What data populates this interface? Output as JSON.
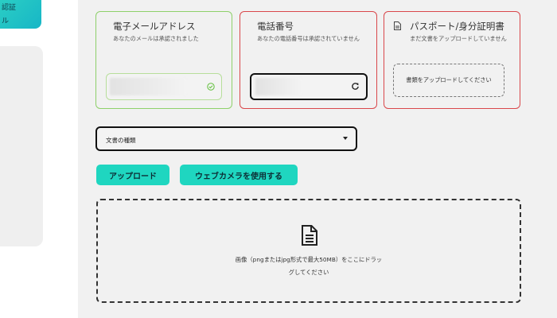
{
  "sidebar": {
    "active_item_lines": [
      "認証",
      "ル"
    ]
  },
  "verification": {
    "email": {
      "title": "電子メールアドレス",
      "description": "あなたのメールは承認されました",
      "status_icon": "check-circle-icon",
      "status_color": "#5fbf3a"
    },
    "phone": {
      "title": "電話番号",
      "description": "あなたの電話番号は承認されていません",
      "action_icon": "refresh-icon"
    },
    "passport": {
      "title": "パスポート/身分証明書",
      "description": "まだ文書をアップロードしていません",
      "icon": "document-icon",
      "upload_label": "書類をアップロードしてください"
    },
    "approved_border_color": "#8ed06a",
    "pending_border_color": "#d9474b"
  },
  "document_type": {
    "selected_label": "文書の種類"
  },
  "actions": {
    "upload_label": "アップロード",
    "webcam_label": "ウェブカメラを使用する",
    "accent_color": "#1fd6c0"
  },
  "dropzone": {
    "icon": "document-icon",
    "line1": "画像（pngまたはjpg形式で最大50MB）をここにドラッ",
    "line2": "グしてください"
  }
}
